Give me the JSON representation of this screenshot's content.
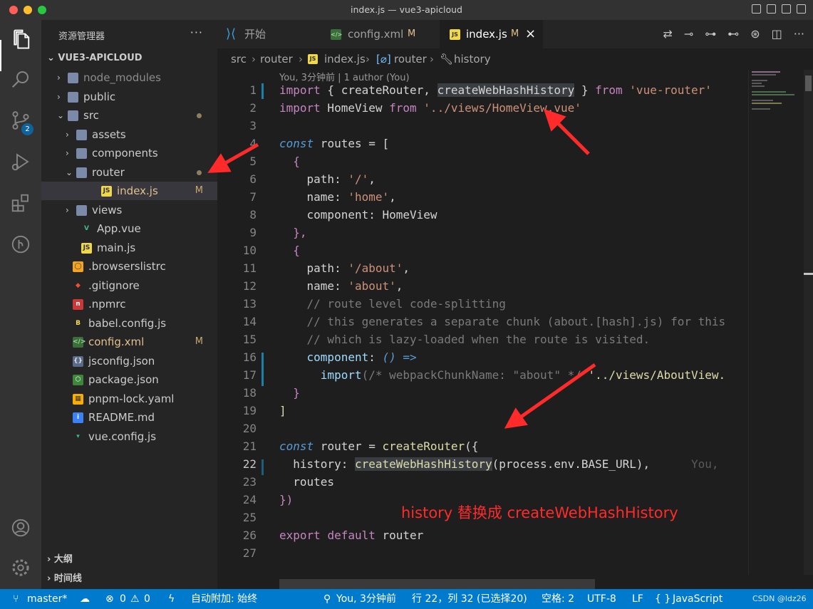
{
  "window": {
    "title": "index.js — vue3-apicloud"
  },
  "activity": {
    "scm_badge": "2"
  },
  "sidebar": {
    "header": "资源管理器",
    "more": "···",
    "project": "VUE3-APICLOUD",
    "tree": [
      {
        "label": "node_modules",
        "chev": "›",
        "icon": "folder",
        "flag": ""
      },
      {
        "label": "public",
        "chev": "›",
        "icon": "folder",
        "flag": ""
      },
      {
        "label": "src",
        "chev": "⌄",
        "icon": "folder",
        "flag": "dot"
      },
      {
        "label": "assets",
        "chev": "›",
        "icon": "folder",
        "flag": ""
      },
      {
        "label": "components",
        "chev": "›",
        "icon": "folder",
        "flag": ""
      },
      {
        "label": "router",
        "chev": "⌄",
        "icon": "folder",
        "flag": "dot"
      },
      {
        "label": "index.js",
        "chev": "",
        "icon": "js",
        "flag": "M"
      },
      {
        "label": "views",
        "chev": "›",
        "icon": "folder",
        "flag": ""
      },
      {
        "label": "App.vue",
        "chev": "",
        "icon": "vue",
        "flag": ""
      },
      {
        "label": "main.js",
        "chev": "",
        "icon": "js",
        "flag": ""
      },
      {
        "label": ".browserslistrc",
        "chev": "",
        "icon": "browsers",
        "flag": ""
      },
      {
        "label": ".gitignore",
        "chev": "",
        "icon": "git",
        "flag": ""
      },
      {
        "label": ".npmrc",
        "chev": "",
        "icon": "npm",
        "flag": ""
      },
      {
        "label": "babel.config.js",
        "chev": "",
        "icon": "babel",
        "flag": ""
      },
      {
        "label": "config.xml",
        "chev": "",
        "icon": "xml",
        "flag": "M"
      },
      {
        "label": "jsconfig.json",
        "chev": "",
        "icon": "json",
        "flag": ""
      },
      {
        "label": "package.json",
        "chev": "",
        "icon": "nodejs",
        "flag": ""
      },
      {
        "label": "pnpm-lock.yaml",
        "chev": "",
        "icon": "pnpm",
        "flag": ""
      },
      {
        "label": "README.md",
        "chev": "",
        "icon": "info",
        "flag": ""
      },
      {
        "label": "vue.config.js",
        "chev": "",
        "icon": "vuecfg",
        "flag": ""
      }
    ],
    "outline": "大纲",
    "timeline": "时间线"
  },
  "tabs": [
    {
      "label": "开始",
      "mod": ""
    },
    {
      "label": "config.xml",
      "mod": "M"
    },
    {
      "label": "index.js",
      "mod": "M",
      "close": "×"
    }
  ],
  "breadcrumb": {
    "src": "src",
    "router": "router",
    "file": "index.js",
    "sym1": "router",
    "sym2": "history"
  },
  "codelens": "You, 3分钟前 | 1 author (You)",
  "ghost_blame": "You,",
  "annotation": "history 替换成 createWebHashHistory",
  "lines": [
    "1",
    "2",
    "3",
    "4",
    "5",
    "6",
    "7",
    "8",
    "9",
    "10",
    "11",
    "12",
    "13",
    "14",
    "15",
    "16",
    "17",
    "18",
    "19",
    "20",
    "21",
    "22",
    "23",
    "24",
    "25",
    "26",
    "27"
  ],
  "code": {
    "import": "import",
    "from": "from",
    "l1_open": " { createRouter, ",
    "l1_hl": "createWebHashHistory",
    "l1_close": " } ",
    "l1_str": "'vue-router'",
    "l2_name": " HomeView ",
    "l2_str": "'../views/HomeView.vue'",
    "const": "const",
    "l4_rest": " routes = [",
    "brace_open": "{",
    "brace_close_comma": "},",
    "brace_close": "}",
    "bracket_close": "]",
    "path": "path",
    "name": "name",
    "component": "component",
    "s_root": "'/'",
    "s_home": "'home'",
    "s_about_path": "'/about'",
    "s_about": "'about'",
    "comma": ",",
    "colon": ": ",
    "l8_rest": ": HomeView",
    "c13": "// route level code-splitting",
    "c14": "// this generates a separate chunk (about.[hash].js) for this",
    "c15": "// which is lazy-loaded when the route is visited.",
    "l16_rest": " () =>",
    "l17_fn": "import",
    "l17_c": "(/* webpackChunkName: \"about\" */ ",
    "l17_s": "'../views/AboutView.",
    "l21_rest": " router = ",
    "l21_fn": "createRouter",
    "l21_end": "({",
    "history": "history",
    "l22_fn": "createWebHashHistory",
    "l22_rest": "(process.env.BASE_URL),",
    "routes": "routes",
    "l24": "})",
    "export": "export",
    "default": "default",
    "l26_rest": " router"
  },
  "status": {
    "branch": "master*",
    "errors": "0",
    "warnings": "0",
    "autoattach": "自动附加: 始终",
    "blame": "You, 3分钟前",
    "position": "行 22，列 32 (已选择20)",
    "spaces": "空格: 2",
    "encoding": "UTF-8",
    "eol": "LF",
    "lang_braces": "{ }",
    "language": "JavaScript",
    "watermark": "CSDN @ldz26"
  },
  "colors": {
    "accent": "#007acc",
    "arrow": "#ff2a2a"
  }
}
